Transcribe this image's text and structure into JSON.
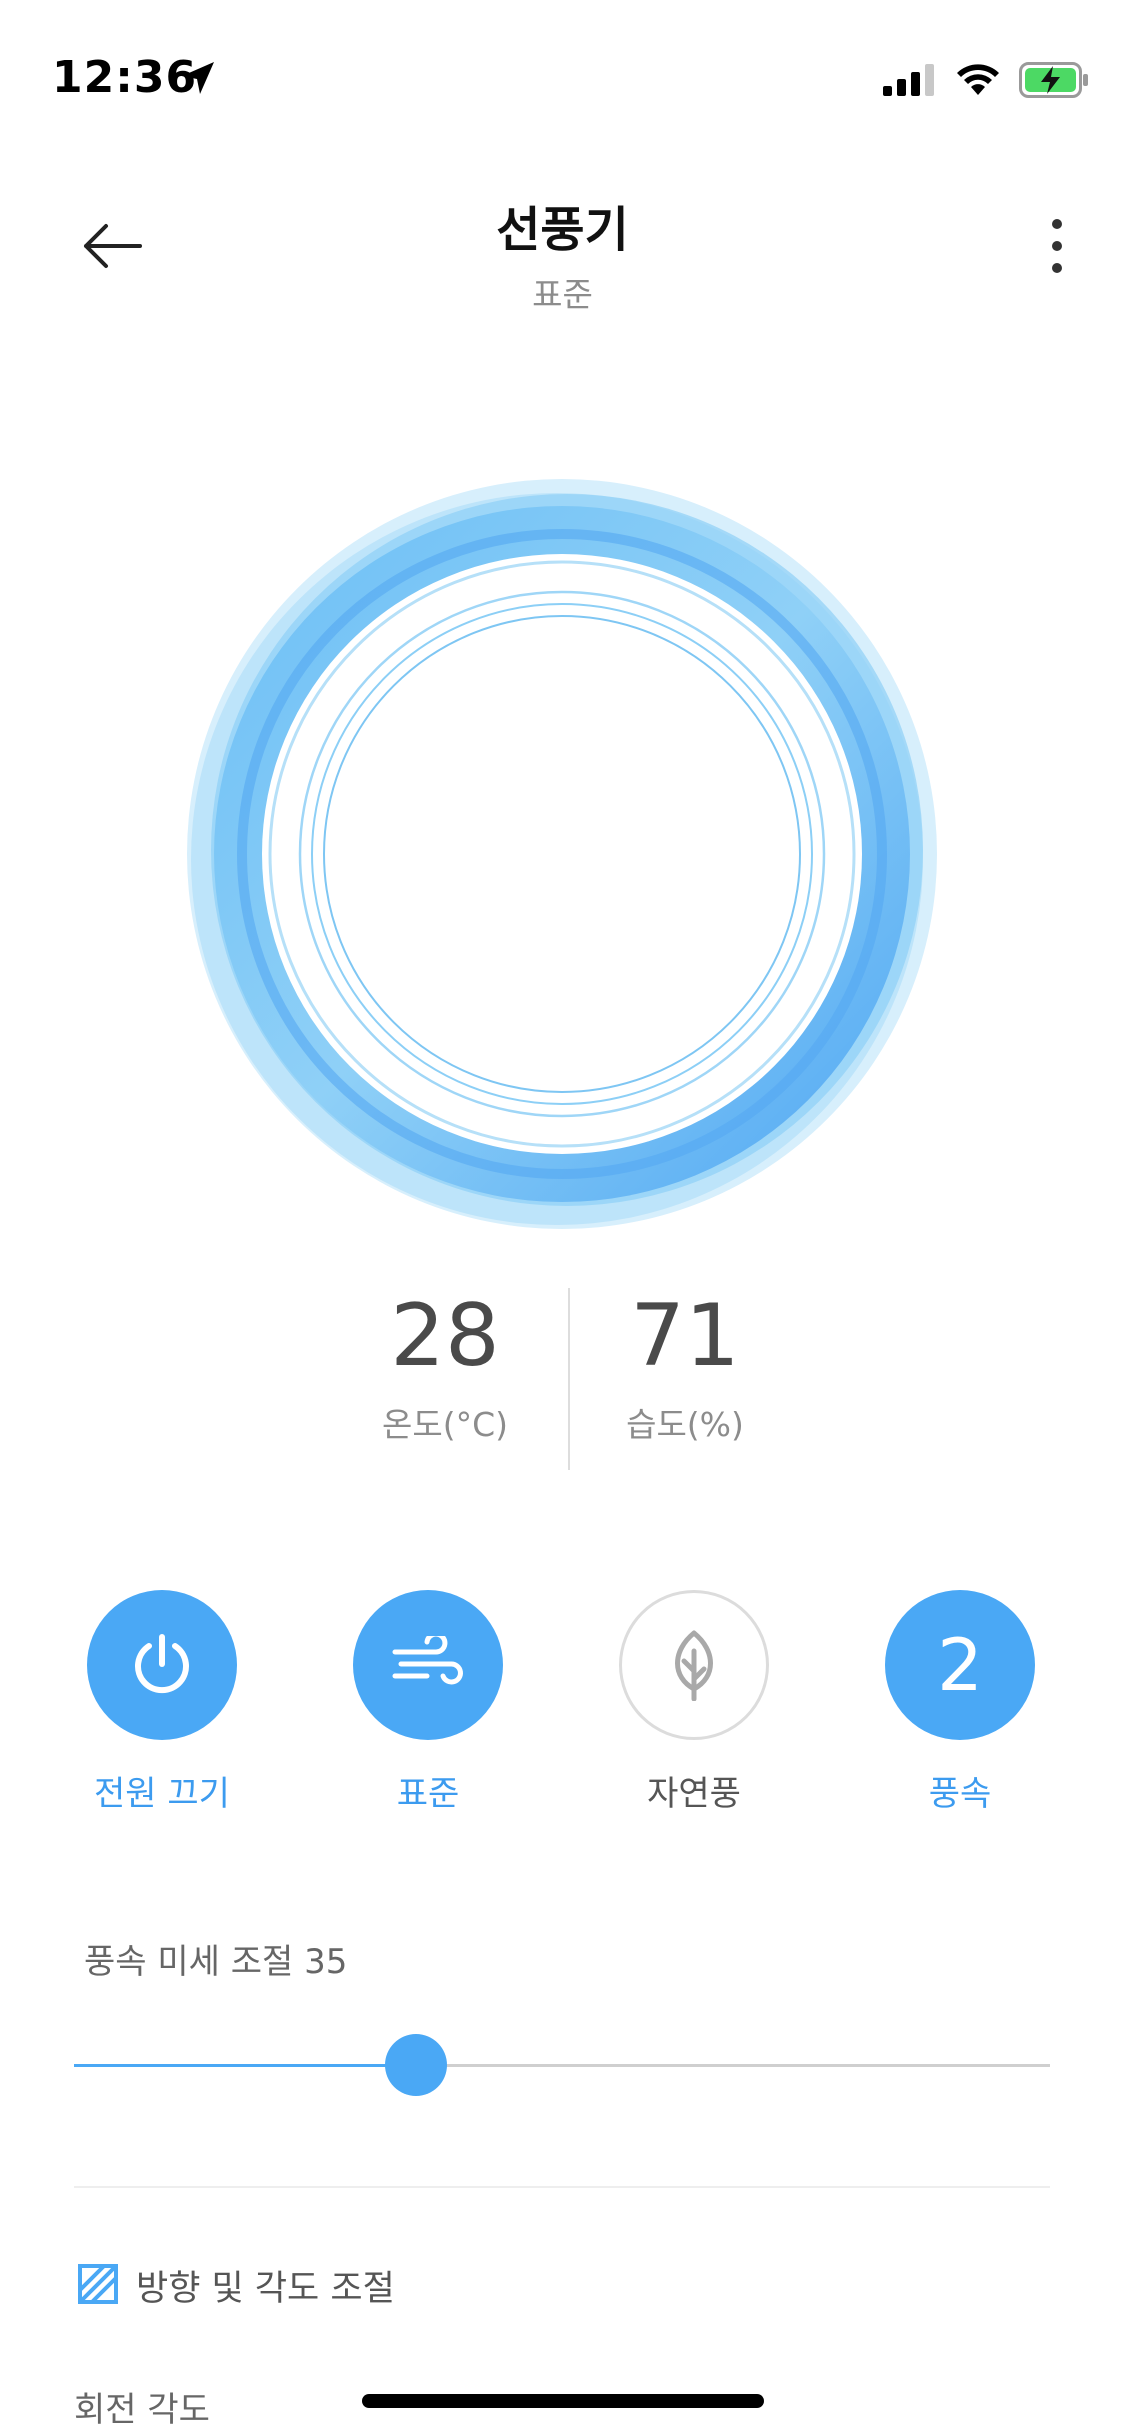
{
  "status_bar": {
    "time": "12:36",
    "location_icon": "location-arrow-icon",
    "signal_icon": "cellular-signal-icon",
    "wifi_icon": "wifi-icon",
    "battery_icon": "battery-charging-icon",
    "battery_color": "#4cd964"
  },
  "header": {
    "title": "선풍기",
    "subtitle": "표준",
    "back_icon": "back-arrow-icon",
    "more_icon": "more-vertical-icon"
  },
  "colors": {
    "accent": "#4aa8f5",
    "accent_text": "#3c9bef",
    "ring_light": "#9fd6f7",
    "ring_dark": "#5aaef3",
    "text_gray": "#8c8c8c"
  },
  "readings": {
    "temperature": {
      "value": "28",
      "label": "온도(°C)"
    },
    "humidity": {
      "value": "71",
      "label": "습도(%)"
    }
  },
  "controls": [
    {
      "label": "전원 끄기",
      "icon": "power-icon",
      "active": true
    },
    {
      "label": "표준",
      "icon": "wind-icon",
      "active": true
    },
    {
      "label": "자연풍",
      "icon": "leaf-icon",
      "active": false
    },
    {
      "label": "풍속",
      "value": "2",
      "active": true
    }
  ],
  "fine_speed": {
    "label": "풍속 미세 조절 35",
    "value": 35,
    "max": 100
  },
  "direction": {
    "icon": "direction-angle-icon",
    "label": "방향 및 각도 조절",
    "rotation_label": "회전 각도"
  }
}
